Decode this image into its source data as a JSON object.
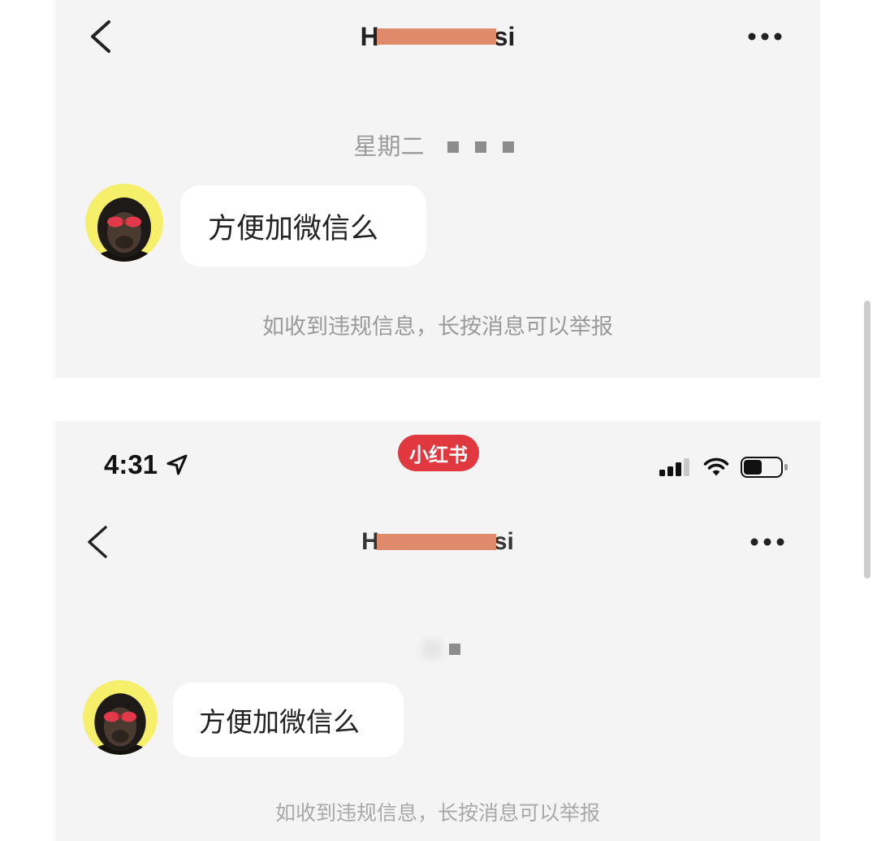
{
  "colors": {
    "page_background": "#ffffff",
    "screen_background": "#f4f4f4",
    "bubble": "#ffffff",
    "text_primary": "#222222",
    "text_secondary": "#9a9a9a",
    "redaction": "#e08a6c",
    "app_badge": "#e0383e",
    "avatar_background": "#f5ef6a"
  },
  "top_screen": {
    "header": {
      "back_icon": "chevron-left-icon",
      "title_start": "H",
      "title_end": "si",
      "more_icon": "more-horizontal-icon"
    },
    "date_label": "星期二",
    "message": {
      "avatar_icon": "chimpanzee-avatar-icon",
      "text": "方便加微信么"
    },
    "report_notice": "如收到违规信息，长按消息可以举报"
  },
  "bottom_screen": {
    "status_bar": {
      "time": "4:31",
      "location_icon": "location-arrow-icon",
      "app_badge": "小红书",
      "signal_icon": "cellular-signal-icon",
      "signal_bars": 3,
      "signal_bars_total": 4,
      "wifi_icon": "wifi-icon",
      "battery_icon": "battery-icon",
      "battery_level": 0.5
    },
    "header": {
      "back_icon": "chevron-left-icon",
      "title_start": "H",
      "title_end": "si",
      "more_icon": "more-horizontal-icon"
    },
    "message": {
      "avatar_icon": "chimpanzee-avatar-icon",
      "text": "方便加微信么"
    },
    "report_notice": "如收到违规信息，长按消息可以举报"
  }
}
